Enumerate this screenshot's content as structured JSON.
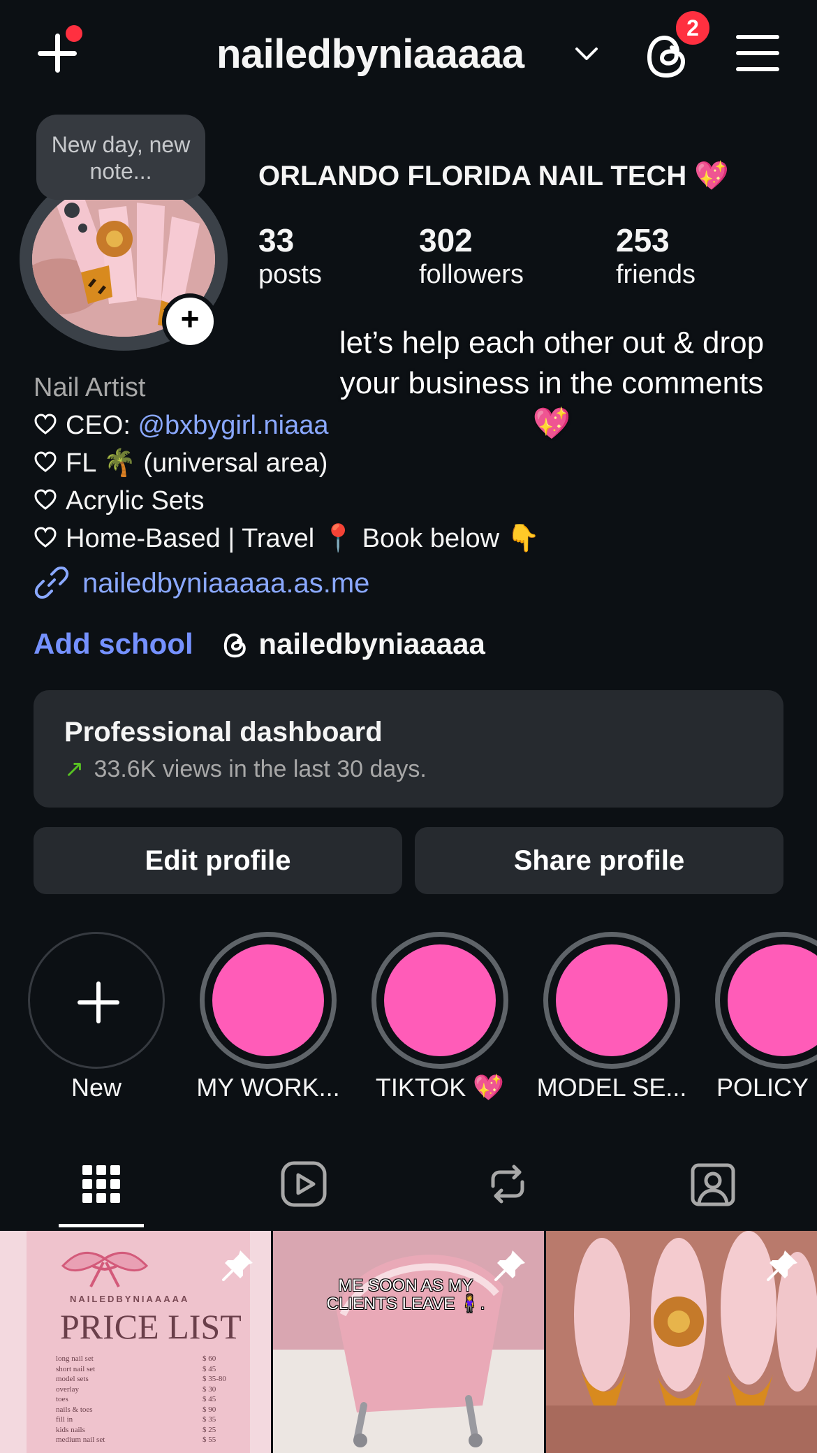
{
  "header": {
    "username": "nailedbyniaaaaa",
    "threads_badge": "2"
  },
  "profile": {
    "note": "New day, new note...",
    "bio_title": "ORLANDO FLORIDA NAIL TECH 💖",
    "stats": [
      {
        "value": "33",
        "label": "posts"
      },
      {
        "value": "302",
        "label": "followers"
      },
      {
        "value": "253",
        "label": "friends"
      }
    ],
    "overlay_text": "let’s help each other out & drop your business in the comments 💖",
    "category": "Nail Artist",
    "bio_lines": {
      "ceo_prefix": "CEO: ",
      "ceo_mention": "@bxbygirl.niaaa",
      "line2": "FL 🌴 (universal area)",
      "line3": "Acrylic Sets",
      "line4": "Home-Based | Travel 📍 Book below 👇"
    },
    "link": "nailedbyniaaaaa.as.me",
    "add_school": "Add school",
    "threads_handle": "nailedbyniaaaaa"
  },
  "dashboard": {
    "title": "Professional dashboard",
    "subtitle": "33.6K views in the last 30 days."
  },
  "buttons": {
    "edit": "Edit profile",
    "share": "Share profile"
  },
  "highlights": [
    {
      "label": "New"
    },
    {
      "label": "MY WORK..."
    },
    {
      "label": "TIKTOK 💖"
    },
    {
      "label": "MODEL SE..."
    },
    {
      "label": "POLICY"
    }
  ],
  "tabs": [
    "grid-icon",
    "reels-icon",
    "reposts-icon",
    "tagged-icon"
  ],
  "grid": {
    "post1": {
      "brand": "NAILEDBYNIAAAAA",
      "title": "PRICE LIST",
      "items": [
        "long nail set",
        "short nail set",
        "model sets",
        "overlay",
        "toes",
        "nails & toes",
        "fill in",
        "kids nails",
        "medium nail set"
      ],
      "prices": [
        "$ 60",
        "$ 45",
        "$ 35-80",
        "$ 30",
        "$ 45",
        "$ 90",
        "$ 35",
        "$ 25",
        "$ 55"
      ]
    },
    "post2": {
      "caption": "ME SOON AS MY CLIENTS LEAVE 🧍‍♀️."
    }
  },
  "colors": {
    "background": "#0c1014",
    "link": "#8aa8ff",
    "accent_blue": "#7591ff",
    "badge_red": "#ff3040",
    "highlight_pink": "#ff5cb8",
    "card": "#262a2f"
  }
}
